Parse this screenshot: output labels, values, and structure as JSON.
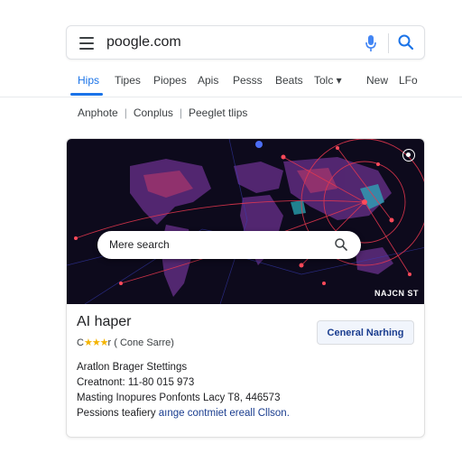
{
  "address_bar": {
    "url": "poogle.com"
  },
  "tabs": [
    {
      "label": "Hips",
      "active": true
    },
    {
      "label": "Tipes"
    },
    {
      "label": "Piopes"
    },
    {
      "label": "Apis"
    },
    {
      "label": "Pesss"
    },
    {
      "label": "Beats"
    },
    {
      "label": "Tolc ▾"
    },
    {
      "label": "New"
    },
    {
      "label": "LFo"
    }
  ],
  "breadcrumb": [
    "Anphote",
    "Conplus",
    "Peeglet tlips"
  ],
  "card": {
    "hero_search_placeholder": "Mere search",
    "hero_badge": "NAJCN ST",
    "title": "AI haper",
    "stars": "★★★",
    "rating_prefix": "C",
    "rating_text": "r ( Cone Sarre)",
    "cta_label": "Ceneral Narhing",
    "lines": [
      "Aratlon Brager Stettings",
      "Creatnont: 11-80 015 973",
      "Masting Inopures Ponfonts Lacy T8, 446573"
    ],
    "last_line_prefix": "Pessions teafiery",
    "last_line_link": "aınge contmiet ereall Cllson."
  },
  "colors": {
    "accent": "#1a73e8",
    "hero_bg": "#0d0a1c",
    "network": "#e8384f",
    "map": "#6b2f8a"
  }
}
